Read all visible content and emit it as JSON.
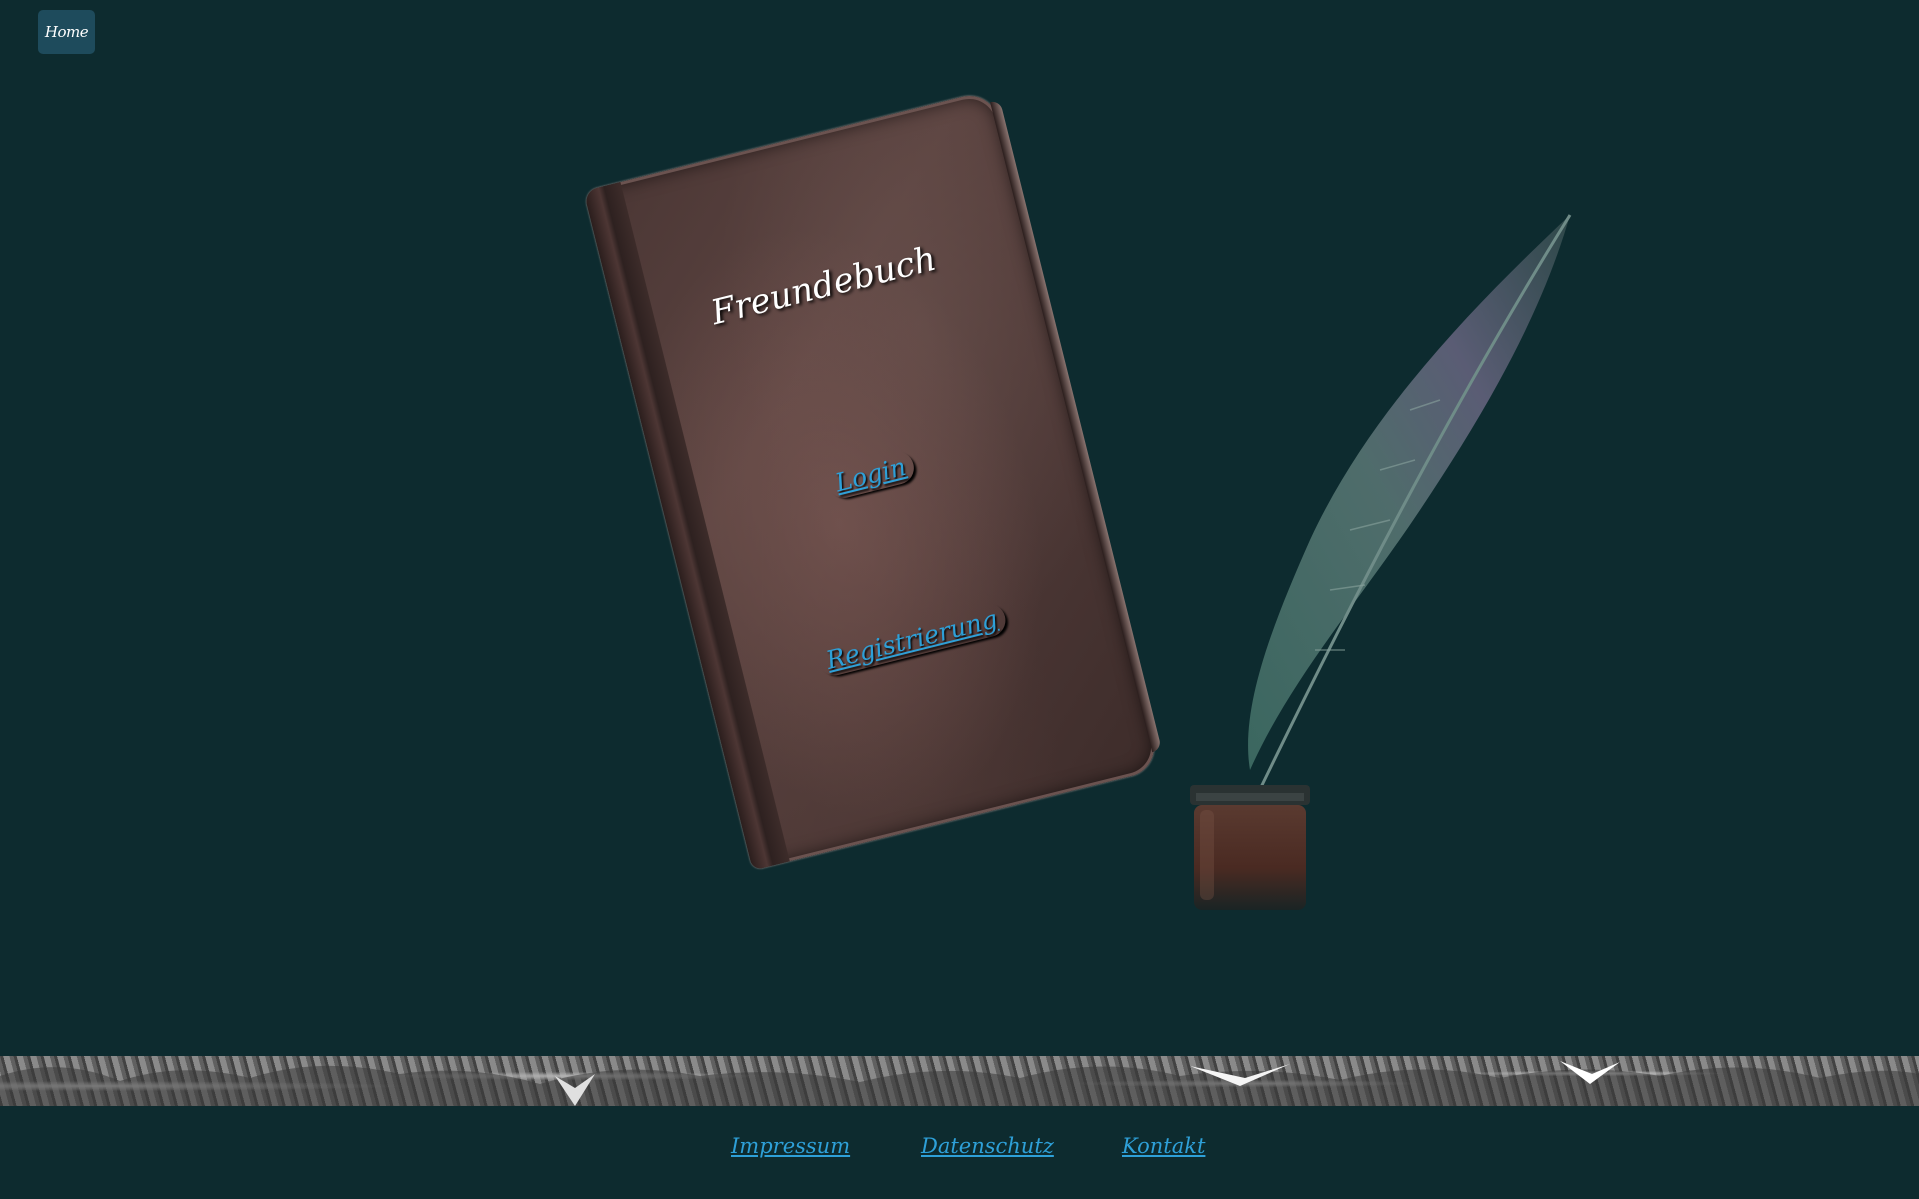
{
  "nav": {
    "home_label": "Home"
  },
  "book": {
    "title": "Freundebuch",
    "login_label": "Login",
    "register_label": "Registrierung"
  },
  "footer": {
    "links": [
      {
        "label": "Impressum"
      },
      {
        "label": "Datenschutz"
      },
      {
        "label": "Kontakt"
      }
    ]
  },
  "colors": {
    "background": "#0d2b2f",
    "home_button": "#1e4b5c",
    "link": "#2ea0d8",
    "book_cover": "#4a3634"
  },
  "icons": {
    "book": "book-illustration",
    "quill": "quill-ink-illustration",
    "banner": "forest-banner-illustration"
  }
}
